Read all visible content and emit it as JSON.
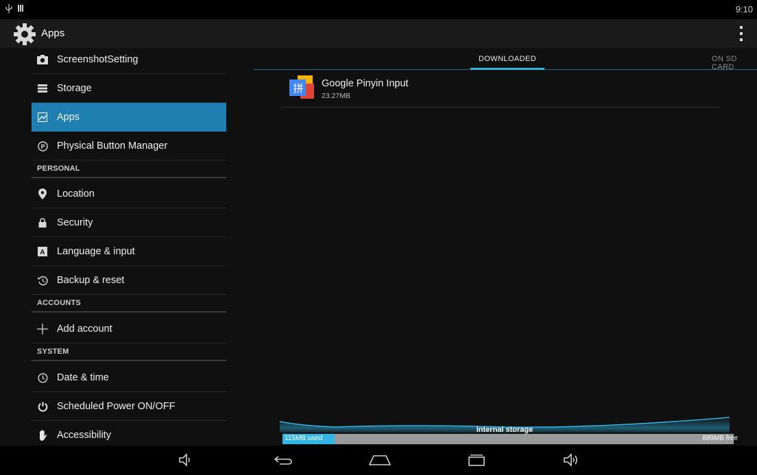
{
  "status_bar": {
    "time": "9:10",
    "icons": [
      "usb-icon",
      "storage-bars-icon"
    ]
  },
  "action_bar": {
    "title": "Apps",
    "icon": "settings-gear-icon",
    "overflow": "overflow-menu-icon"
  },
  "sidebar": {
    "items": [
      {
        "label": "ScreenshotSetting",
        "icon": "camera-icon"
      },
      {
        "label": "Storage",
        "icon": "storage-icon"
      },
      {
        "label": "Apps",
        "icon": "apps-icon",
        "selected": true
      },
      {
        "label": "Physical Button Manager",
        "icon": "p-circle-icon"
      }
    ],
    "personal_header": "PERSONAL",
    "personal": [
      {
        "label": "Location",
        "icon": "location-pin-icon"
      },
      {
        "label": "Security",
        "icon": "lock-icon"
      },
      {
        "label": "Language & input",
        "icon": "keyboard-a-icon"
      },
      {
        "label": "Backup & reset",
        "icon": "restore-icon"
      }
    ],
    "accounts_header": "ACCOUNTS",
    "accounts": [
      {
        "label": "Add account",
        "icon": "plus-icon"
      }
    ],
    "system_header": "SYSTEM",
    "system": [
      {
        "label": "Date & time",
        "icon": "clock-icon"
      },
      {
        "label": "Scheduled Power ON/OFF",
        "icon": "power-icon"
      },
      {
        "label": "Accessibility",
        "icon": "hand-icon"
      }
    ]
  },
  "tabs": [
    {
      "label": "DOWNLOADED",
      "active": true
    },
    {
      "label": "ON SD CARD",
      "active": false
    }
  ],
  "apps": [
    {
      "name": "Google Pinyin Input",
      "size": "23.27MB",
      "icon_glyph": "拼"
    }
  ],
  "storage": {
    "label": "Internal storage",
    "used": "115MB used",
    "free": "889MB free",
    "used_fraction": 0.115
  },
  "nav_bar": [
    "volume-down-icon",
    "back-icon",
    "home-icon",
    "recents-icon",
    "volume-up-icon"
  ],
  "colors": {
    "accent": "#33b5e5",
    "selected": "#1e7fb0",
    "background": "#101010"
  }
}
